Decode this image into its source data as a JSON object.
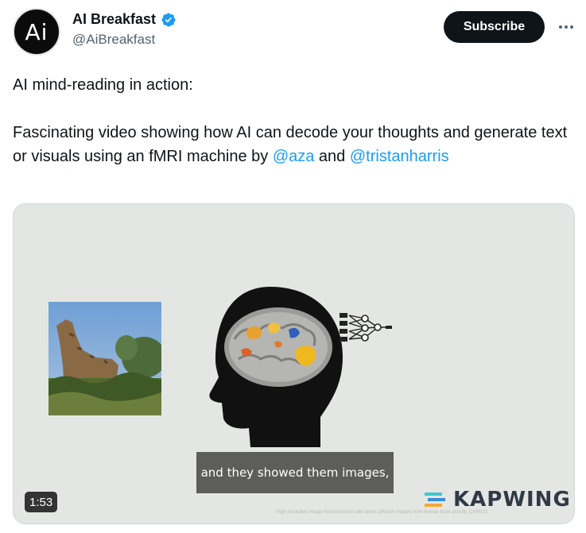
{
  "author": {
    "display_name": "AI Breakfast",
    "handle": "@AiBreakfast",
    "avatar_text": "Ai",
    "verified_icon": "verified-badge-icon",
    "verified_color": "#1d9bf0"
  },
  "actions": {
    "subscribe_label": "Subscribe",
    "more_icon": "more-horizontal-icon"
  },
  "tweet": {
    "line1": "AI mind-reading in action:",
    "line2_pre": "Fascinating video showing how AI can decode your thoughts and generate text or visuals using an fMRI machine by ",
    "mention1": "@aza",
    "line2_mid": " and ",
    "mention2": "@tristanharris",
    "mention_color": "#1d9bf0"
  },
  "media": {
    "caption": "and they showed them images,",
    "duration": "1:53",
    "watermark": "KAPWING",
    "fine_print": "High-resolution image reconstruction with latent diffusion models from human brain activity, CVPR23",
    "head_icon": "brain-head-icon",
    "network_icon": "neural-network-icon",
    "photo_subject": "giraffe-photo"
  }
}
